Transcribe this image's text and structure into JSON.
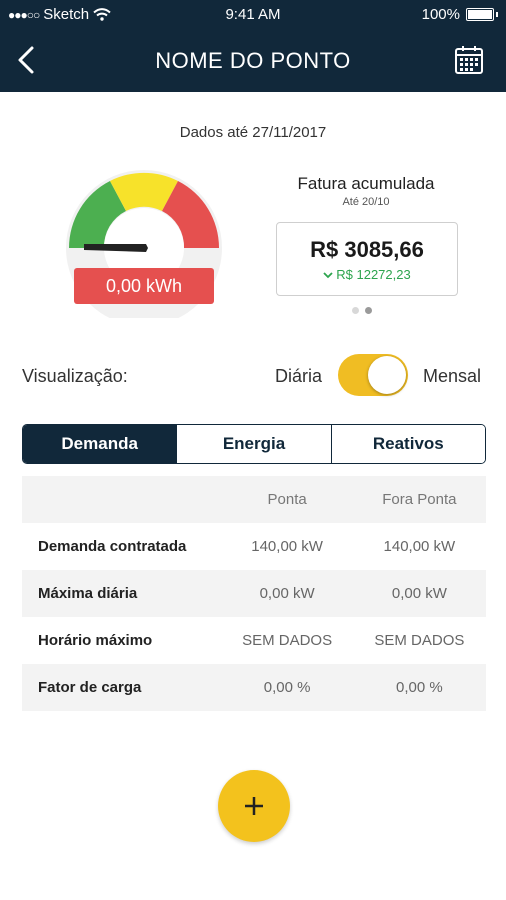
{
  "status_bar": {
    "carrier": "Sketch",
    "time": "9:41 AM",
    "battery": "100%"
  },
  "nav": {
    "title": "NOME DO PONTO",
    "back_icon": "chevron-left-icon",
    "calendar_icon": "calendar-icon"
  },
  "summary": {
    "data_date": "Dados até 27/11/2017",
    "gauge_value": "0,00 kWh",
    "gauge_level": 0,
    "gauge_colors": [
      "#4caf50",
      "#f7e22a",
      "#e5504f"
    ],
    "invoice_title": "Fatura acumulada",
    "invoice_sub": "Até 20/10",
    "invoice_amount": "R$ 3085,66",
    "invoice_delta": "R$ 12272,23",
    "pager_active": 2,
    "pager_total": 2
  },
  "view": {
    "label": "Visualização:",
    "daily": "Diária",
    "monthly": "Mensal",
    "selected": "Mensal",
    "accent": "#f0bd23"
  },
  "tabs": [
    {
      "label": "Demanda",
      "active": true
    },
    {
      "label": "Energia",
      "active": false
    },
    {
      "label": "Reativos",
      "active": false
    }
  ],
  "table": {
    "headers": [
      "",
      "Ponta",
      "Fora Ponta"
    ],
    "rows": [
      [
        "Demanda contratada",
        "140,00 kW",
        "140,00 kW"
      ],
      [
        "Máxima diária",
        "0,00 kW",
        "0,00 kW"
      ],
      [
        "Horário máximo",
        "SEM DADOS",
        "SEM DADOS"
      ],
      [
        "Fator de carga",
        "0,00 %",
        "0,00 %"
      ]
    ]
  },
  "fab": {
    "icon": "plus-icon",
    "color": "#f3c21d"
  }
}
